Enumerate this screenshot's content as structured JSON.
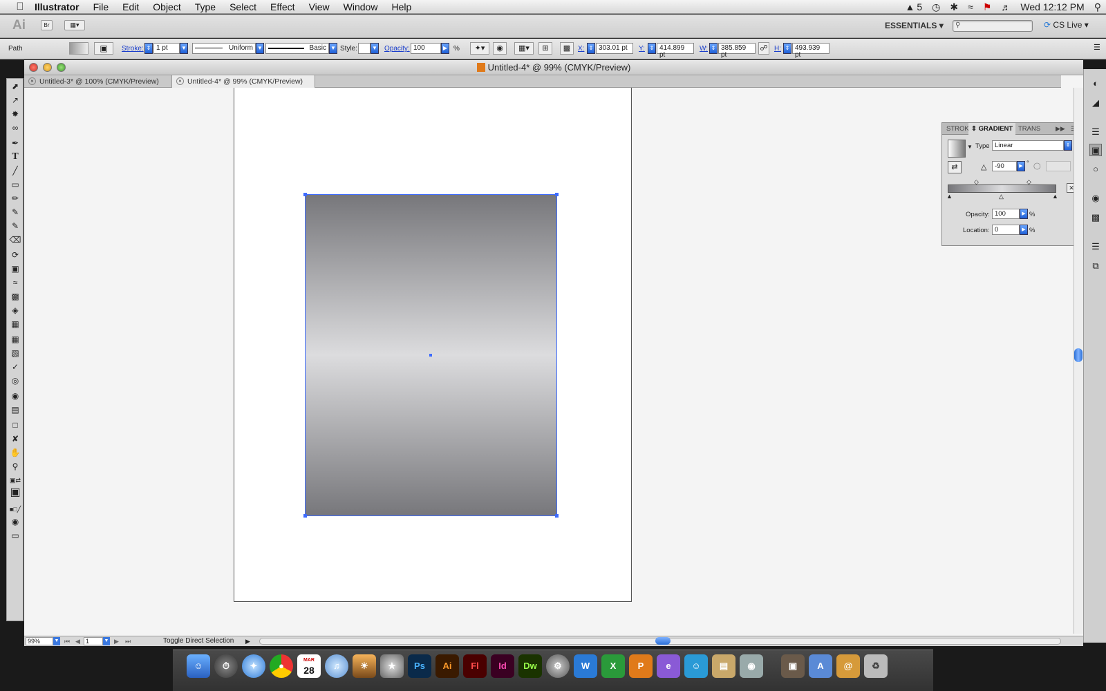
{
  "menubar": {
    "app_name": "Illustrator",
    "items": [
      "File",
      "Edit",
      "Object",
      "Type",
      "Select",
      "Effect",
      "View",
      "Window",
      "Help"
    ],
    "status_badge": "5",
    "clock": "Wed 12:12 PM"
  },
  "appbar": {
    "logo": "Ai",
    "bridge": "Br",
    "workspace": "ESSENTIALS",
    "cs_live": "CS Live"
  },
  "control": {
    "selection_type": "Path",
    "stroke_label": "Stroke:",
    "stroke_value": "1 pt",
    "profile": "Uniform",
    "brush": "Basic",
    "style_label": "Style:",
    "opacity_label": "Opacity:",
    "opacity_value": "100",
    "opacity_unit": "%",
    "x_label": "X:",
    "x_value": "303.01 pt",
    "y_label": "Y:",
    "y_value": "414.899 pt",
    "w_label": "W:",
    "w_value": "385.859 pt",
    "h_label": "H:",
    "h_value": "493.939 pt"
  },
  "window": {
    "title": "Untitled-4* @ 99% (CMYK/Preview)",
    "tabs": [
      {
        "label": "Untitled-3* @ 100% (CMYK/Preview)"
      },
      {
        "label": "Untitled-4* @ 99% (CMYK/Preview)"
      }
    ]
  },
  "gradient_panel": {
    "tabs": [
      "STROK",
      "GRADIENT",
      "TRANS"
    ],
    "type_label": "Type",
    "type_value": "Linear",
    "angle_value": "-90",
    "angle_unit": "°",
    "opacity_label": "Opacity:",
    "opacity_value": "100",
    "opacity_unit": "%",
    "location_label": "Location:",
    "location_value": "0",
    "location_unit": "%",
    "ratio_unit": "%"
  },
  "status": {
    "zoom": "99%",
    "artboard": "1",
    "hint": "Toggle Direct Selection"
  },
  "dock": {
    "calendar_month": "MAR",
    "calendar_day": "28",
    "apps": [
      "Ps",
      "Ai",
      "Fl",
      "Id",
      "Dw"
    ]
  },
  "colors": {
    "selection": "#3d6bff",
    "gradient_dark": "#77777b",
    "gradient_light": "#dcdcde"
  }
}
